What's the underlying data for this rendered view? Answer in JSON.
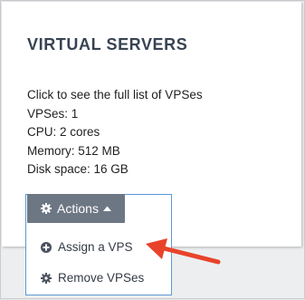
{
  "panel": {
    "title": "VIRTUAL SERVERS",
    "link_text": "Click to see the full list of VPSes",
    "stats": [
      "VPSes: 1",
      "CPU: 2 cores",
      "Memory: 512 MB",
      "Disk space: 16 GB"
    ]
  },
  "actions": {
    "button_label": "Actions",
    "menu_items": [
      {
        "label": "Assign a VPS",
        "icon": "plus-circle-icon"
      },
      {
        "label": "Remove VPSes",
        "icon": "gear-icon"
      }
    ]
  },
  "colors": {
    "title": "#384353",
    "button_bg": "#6d7784",
    "menu_border": "#5b9ad5",
    "annotation_arrow": "#e8432a"
  }
}
